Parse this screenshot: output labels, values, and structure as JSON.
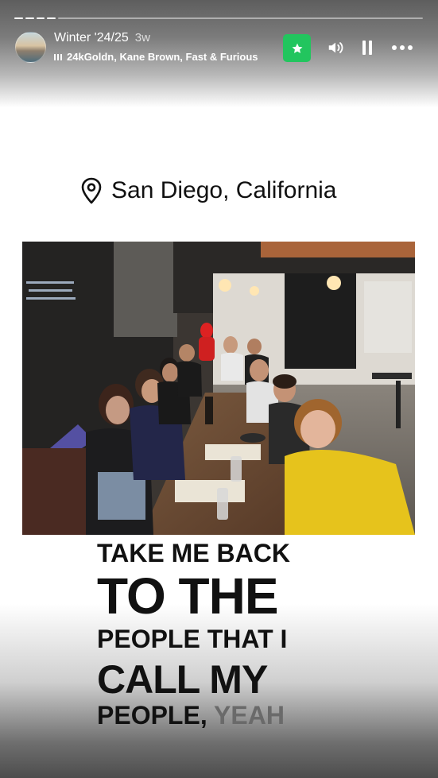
{
  "story": {
    "title": "Winter '24/25",
    "age": "3w",
    "music": "24kGoldn, Kane Brown, Fast & Furious"
  },
  "progress": {
    "segments": 5,
    "current": 2
  },
  "location": {
    "text": "San Diego, California"
  },
  "lyrics": {
    "line1": "TAKE ME BACK",
    "line2": "TO THE",
    "line3": "PEOPLE THAT I",
    "line4": "CALL MY",
    "line5_a": "PEOPLE,",
    "line5_b": "YEAH"
  },
  "icons": {
    "favorite": "star-icon",
    "sound": "speaker-icon",
    "pause": "pause-icon",
    "more": "more-icon",
    "location": "map-pin-icon",
    "music": "music-bars-icon"
  },
  "colors": {
    "favorite_bg": "#22c55e",
    "text": "#111111"
  }
}
